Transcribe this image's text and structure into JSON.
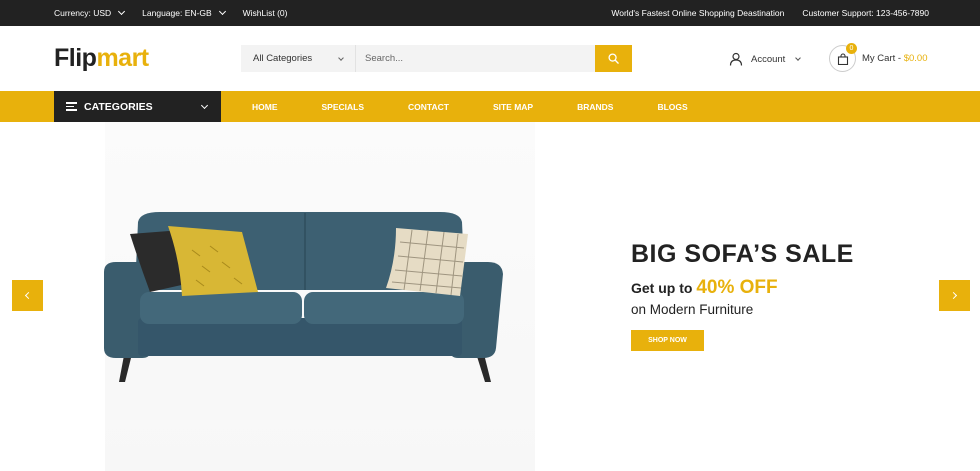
{
  "topbar": {
    "currency": "Currency: USD",
    "language": "Language: EN-GB",
    "wishlist": "WishList (0)",
    "tagline": "World's Fastest Online Shopping Deastination",
    "support": "Customer Support: 123-456-7890"
  },
  "logo": {
    "part1": "Flip",
    "part2": "mart"
  },
  "search": {
    "category": "All Categories",
    "placeholder": "Search..."
  },
  "account": {
    "label": "Account"
  },
  "cart": {
    "count": "0",
    "label": "My Cart - ",
    "price": "$0.00"
  },
  "nav": {
    "categories": "CATEGORIES",
    "items": [
      "HOME",
      "SPECIALS",
      "CONTACT",
      "SITE MAP",
      "BRANDS",
      "BLOGS"
    ]
  },
  "hero": {
    "title": "BIG SOFA’S SALE",
    "line2_prefix": "Get up to ",
    "line2_highlight": "40% OFF",
    "line3": "on Modern Furniture",
    "button": "SHOP NOW"
  },
  "colors": {
    "accent": "#e8b10c",
    "dark": "#222222",
    "sofa": "#3d6072"
  }
}
